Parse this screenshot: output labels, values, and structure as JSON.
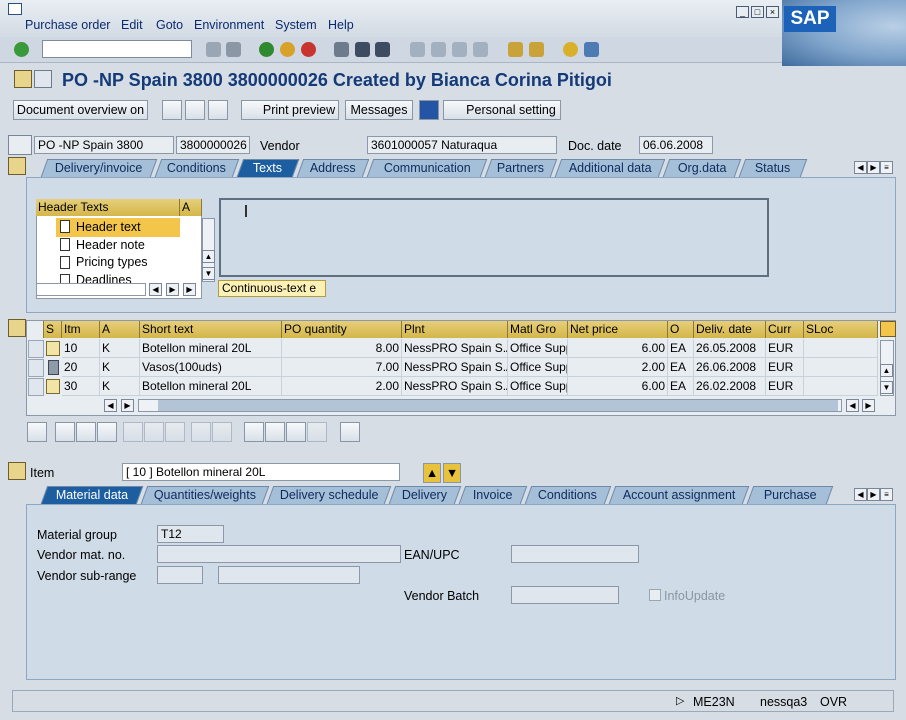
{
  "menu": [
    "Purchase order",
    "Edit",
    "Goto",
    "Environment",
    "System",
    "Help"
  ],
  "title": "PO -NP Spain 3800 3800000026 Created by Bianca Corina Pitigoi",
  "app_buttons": {
    "doc_overview": "Document overview on",
    "print_preview": "Print preview",
    "messages": "Messages",
    "personal_setting": "Personal setting"
  },
  "header": {
    "po_type": "PO -NP Spain 3800",
    "po_number": "3800000026",
    "vendor_label": "Vendor",
    "vendor_value": "3601000057 Naturaqua",
    "doc_date_label": "Doc. date",
    "doc_date_value": "06.06.2008"
  },
  "header_tabs": [
    "Delivery/invoice",
    "Conditions",
    "Texts",
    "Address",
    "Communication",
    "Partners",
    "Additional data",
    "Org.data",
    "Status"
  ],
  "texts_panel": {
    "col_header": "Header Texts",
    "col_a": "A",
    "items": [
      "Header text",
      "Header note",
      "Pricing types",
      "Deadlines"
    ],
    "dropdown": "Continuous-text e"
  },
  "grid": {
    "headers": [
      "S",
      "Itm",
      "A",
      "Short text",
      "PO quantity",
      "Plnt",
      "Matl Gro",
      "Net price",
      "O",
      "Deliv. date",
      "Curr",
      "SLoc"
    ],
    "rows": [
      {
        "itm": "10",
        "a": "K",
        "text": "Botellon mineral 20L",
        "qty": "8.00",
        "plant": "NessPRO Spain S.A",
        "matl": "Office Supp",
        "price": "6.00",
        "unit": "EA",
        "date": "26.05.2008",
        "curr": "EUR"
      },
      {
        "itm": "20",
        "a": "K",
        "text": "Vasos(100uds)",
        "qty": "7.00",
        "plant": "NessPRO Spain S.A",
        "matl": "Office Supp",
        "price": "2.00",
        "unit": "EA",
        "date": "26.06.2008",
        "curr": "EUR"
      },
      {
        "itm": "30",
        "a": "K",
        "text": "Botellon mineral 20L",
        "qty": "2.00",
        "plant": "NessPRO Spain S.A",
        "matl": "Office Supp",
        "price": "6.00",
        "unit": "EA",
        "date": "26.02.2008",
        "curr": "EUR"
      }
    ]
  },
  "item": {
    "label": "Item",
    "value": "[ 10 ] Botellon mineral 20L"
  },
  "item_tabs": [
    "Material data",
    "Quantities/weights",
    "Delivery schedule",
    "Delivery",
    "Invoice",
    "Conditions",
    "Account assignment",
    "Purchase"
  ],
  "material": {
    "group_label": "Material group",
    "group_value": "T12",
    "vendor_mat_label": "Vendor mat. no.",
    "ean_label": "EAN/UPC",
    "subrange_label": "Vendor sub-range",
    "batch_label": "Vendor Batch",
    "infoupdate_label": "InfoUpdate"
  },
  "status": {
    "tcode": "ME23N",
    "server": "nessqa3",
    "mode": "OVR"
  },
  "colors": {
    "accent": "#1d5ea0",
    "title": "#143a78",
    "grid_header": "#d4b64a"
  }
}
